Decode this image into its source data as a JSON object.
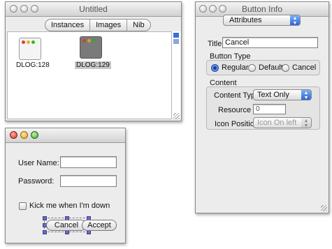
{
  "main_window": {
    "title": "Untitled",
    "tabs": [
      "Instances",
      "Images",
      "Nib"
    ],
    "items": [
      {
        "label": "DLOG:128",
        "selected": false
      },
      {
        "label": "DLOG:129",
        "selected": true
      }
    ]
  },
  "dialog": {
    "username_label": "User Name:",
    "username_value": "",
    "password_label": "Password:",
    "password_value": "",
    "checkbox_label": "Kick me when I'm down",
    "cancel_label": "Cancel",
    "accept_label": "Accept"
  },
  "info": {
    "title": "Button Info",
    "pane_popup": "Attributes",
    "title_label": "Title:",
    "title_value": "Cancel",
    "button_type_heading": "Button Type",
    "button_types": [
      {
        "label": "Regular",
        "selected": true
      },
      {
        "label": "Default",
        "selected": false
      },
      {
        "label": "Cancel",
        "selected": false
      }
    ],
    "content_heading": "Content",
    "content_type_label": "Content Type:",
    "content_type_value": "Text Only",
    "resource_id_label": "Resource ID:",
    "resource_id_value": "0",
    "icon_position_label": "Icon Position:",
    "icon_position_value": "Icon On left"
  },
  "colors": {
    "accent": "#2c66d4",
    "selection": "#6a6acc"
  }
}
